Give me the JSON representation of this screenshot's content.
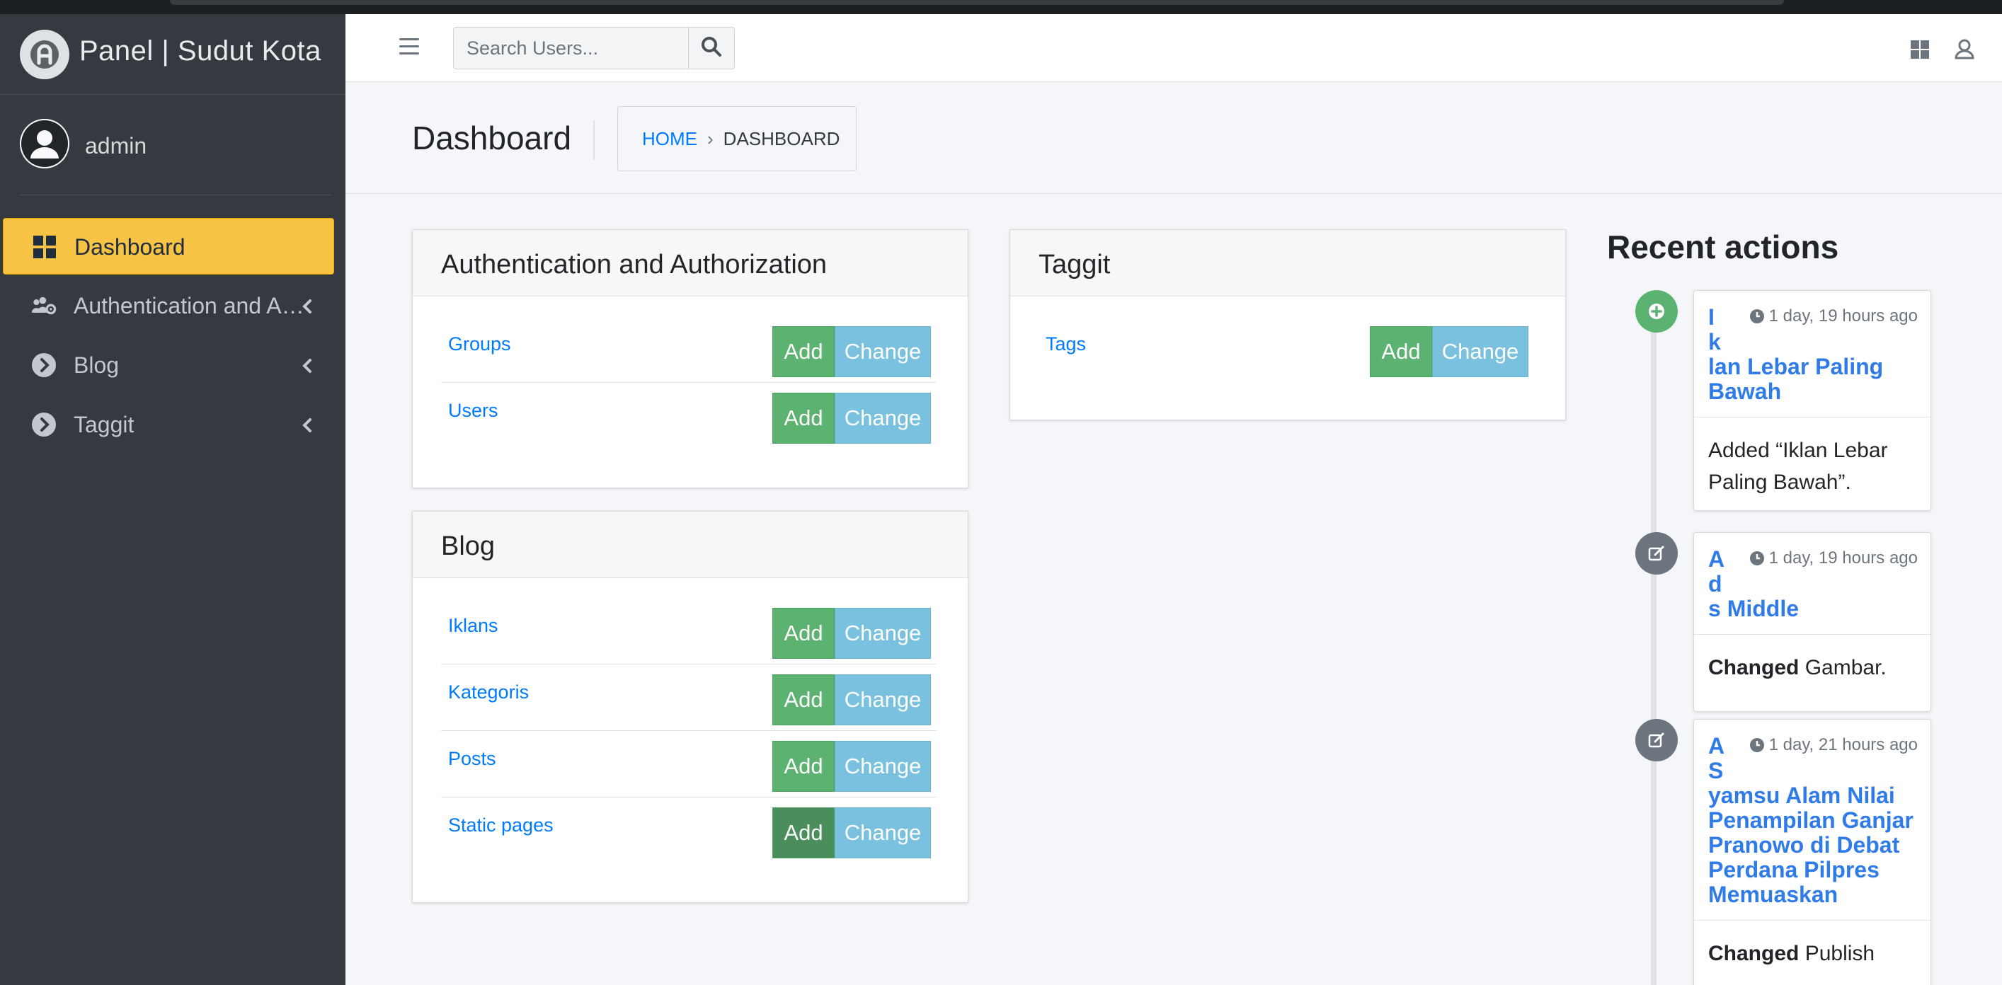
{
  "app": {
    "brand": "Panel | Sudut Kota",
    "user": "admin"
  },
  "sidebar": {
    "items": [
      {
        "label": "Dashboard",
        "icon": "dashboard-icon",
        "active": true
      },
      {
        "label": "Authentication and A…",
        "icon": "users-cog-icon"
      },
      {
        "label": "Blog",
        "icon": "chevron-circle-right-icon"
      },
      {
        "label": "Taggit",
        "icon": "chevron-circle-right-icon"
      }
    ]
  },
  "topbar": {
    "search_placeholder": "Search Users..."
  },
  "header": {
    "title": "Dashboard",
    "breadcrumb_home": "HOME",
    "breadcrumb_separator": "›",
    "breadcrumb_current": "DASHBOARD"
  },
  "buttons": {
    "add": "Add",
    "change": "Change"
  },
  "apps": [
    {
      "title": "Authentication and Authorization",
      "models": [
        "Groups",
        "Users"
      ]
    },
    {
      "title": "Taggit",
      "models": [
        "Tags"
      ]
    },
    {
      "title": "Blog",
      "models": [
        "Iklans",
        "Kategoris",
        "Posts",
        "Static pages"
      ]
    }
  ],
  "recent": {
    "title": "Recent actions",
    "actions": [
      {
        "type": "added",
        "object": "I\nk\nlan Lebar Paling Bawah",
        "time": "1 day, 19 hours ago",
        "message": "Added “Iklan Lebar Paling Bawah”."
      },
      {
        "type": "changed",
        "object": "A\nd\ns Middle",
        "time": "1 day, 19 hours ago",
        "message_bold": "Changed",
        "message_rest": "Gambar."
      },
      {
        "type": "changed",
        "object": "A\nS\nyamsu Alam Nilai Penampilan Ganjar Pranowo di Debat Perdana Pilpres Memuaskan",
        "time": "1 day, 21 hours ago",
        "message_bold": "Changed",
        "message_rest": "Publish"
      }
    ]
  },
  "colors": {
    "sidebar_bg": "#343a40",
    "active_item": "#f6c344",
    "add_button": "#5cb270",
    "change_button": "#79c1de",
    "link": "#007bff"
  }
}
